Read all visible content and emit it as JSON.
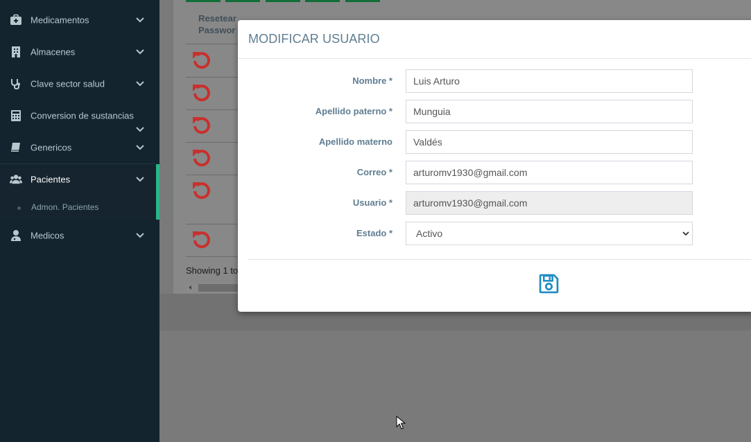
{
  "sidebar": {
    "items": [
      {
        "label": "Medicamentos",
        "icon": "medkit-icon"
      },
      {
        "label": "Almacenes",
        "icon": "hospital-building-icon"
      },
      {
        "label": "Clave sector salud",
        "icon": "stethoscope-icon"
      },
      {
        "label": "Conversion de sustancias",
        "icon": "calculator-icon"
      },
      {
        "label": "Genericos",
        "icon": "book-icon"
      },
      {
        "label": "Pacientes",
        "icon": "users-icon"
      },
      {
        "label": "Medicos",
        "icon": "user-md-icon"
      }
    ],
    "subitems": [
      {
        "label": "Admon. Pacientes"
      }
    ],
    "active_color": "#2bb589"
  },
  "background": {
    "column_header": "Resetear Password",
    "column_header_line1": "Resetear",
    "column_header_line2": "Passwor",
    "reset_icon": "undo-icon",
    "reset_color": "#c9302c",
    "showing_text": "Showing 1 to"
  },
  "modal": {
    "title": "MODIFICAR USUARIO",
    "fields": {
      "nombre": {
        "label": "Nombre *",
        "value": "Luis Arturo"
      },
      "apellido_paterno": {
        "label": "Apellido paterno *",
        "value": "Munguia"
      },
      "apellido_materno": {
        "label": "Apellido materno",
        "value": "Valdés"
      },
      "correo": {
        "label": "Correo *",
        "value": "arturomv1930@gmail.com"
      },
      "usuario": {
        "label": "Usuario *",
        "value": "arturomv1930@gmail.com"
      },
      "estado": {
        "label": "Estado *",
        "value": "Activo"
      }
    },
    "save_icon": "save-icon",
    "save_color": "#1e8bc3"
  }
}
